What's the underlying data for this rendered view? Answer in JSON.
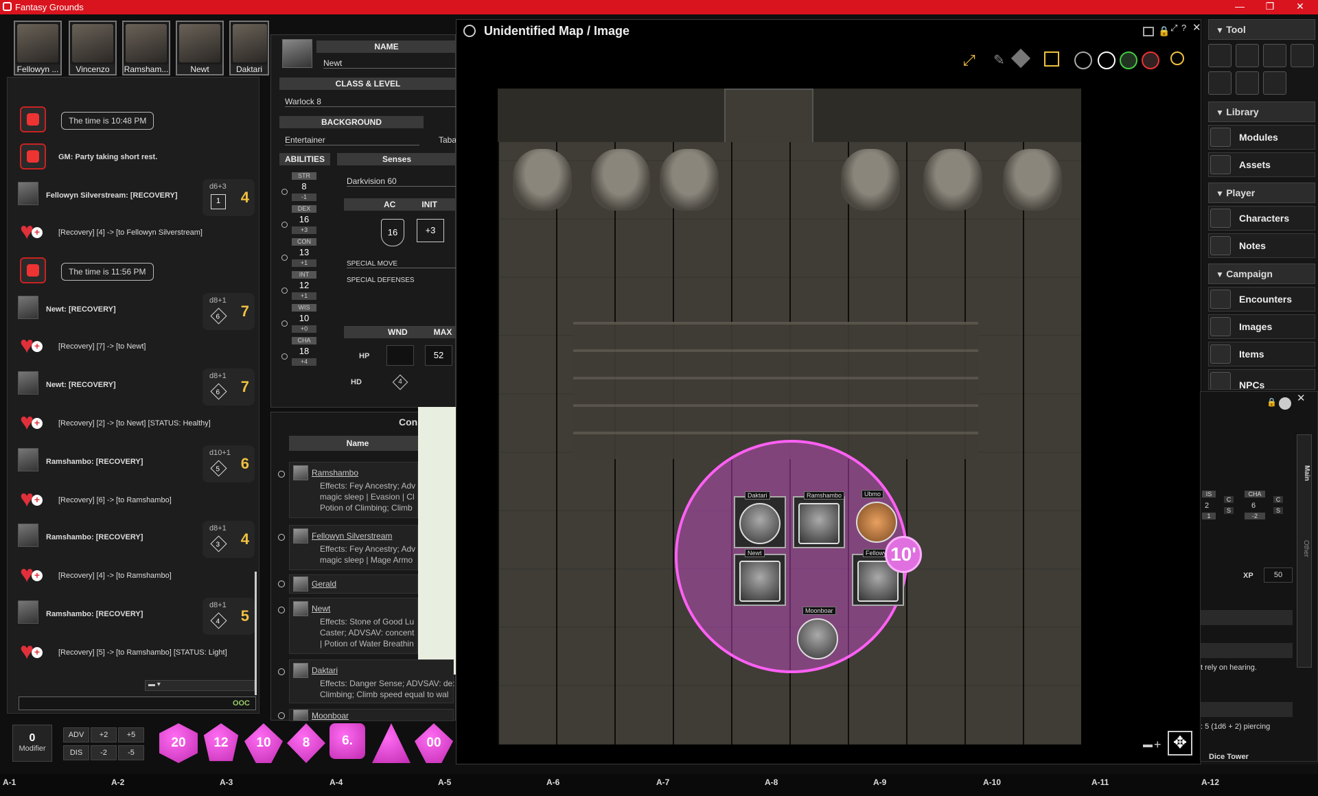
{
  "app": {
    "title": "Fantasy Grounds"
  },
  "party": [
    {
      "name": "Fellowyn ..."
    },
    {
      "name": "Vincenzo"
    },
    {
      "name": "Ramsham..."
    },
    {
      "name": "Newt"
    },
    {
      "name": "Daktari"
    }
  ],
  "chat": {
    "time1": "The time is 10:48 PM",
    "gm_msg": "GM:  Party taking short rest.",
    "time2": "The time is 11:56 PM",
    "ooc": "OOC",
    "rows": [
      {
        "actor": "Fellowyn Silverstream:",
        "tag": "[RECOVERY]",
        "formula": "d6+3",
        "die": "1",
        "total": "4"
      },
      {
        "text": "[Recovery] [4] -> [to Fellowyn Silverstream]"
      },
      {
        "actor": "Newt:",
        "tag": "[RECOVERY]",
        "formula": "d8+1",
        "die": "6",
        "total": "7"
      },
      {
        "text": "[Recovery] [7] -> [to Newt]"
      },
      {
        "actor": "Newt:",
        "tag": "[RECOVERY]",
        "formula": "d8+1",
        "die": "6",
        "total": "7"
      },
      {
        "text": "[Recovery] [2] -> [to Newt] [STATUS: Healthy]"
      },
      {
        "actor": "Ramshambo:",
        "tag": "[RECOVERY]",
        "formula": "d10+1",
        "die": "5",
        "total": "6"
      },
      {
        "text": "[Recovery] [6] -> [to Ramshambo]"
      },
      {
        "actor": "Ramshambo:",
        "tag": "[RECOVERY]",
        "formula": "d8+1",
        "die": "3",
        "total": "4"
      },
      {
        "text": "[Recovery] [4] -> [to Ramshambo]"
      },
      {
        "actor": "Ramshambo:",
        "tag": "[RECOVERY]",
        "formula": "d8+1",
        "die": "4",
        "total": "5"
      },
      {
        "text": "[Recovery] [5] -> [to Ramshambo] [STATUS: Light]"
      }
    ]
  },
  "modifier": {
    "value": "0",
    "label": "Modifier",
    "adv": "ADV",
    "dis": "DIS",
    "p2": "+2",
    "p5": "+5",
    "m2": "-2",
    "m5": "-5"
  },
  "dice": [
    "20",
    "12",
    "10",
    "8",
    "6.",
    "",
    "00"
  ],
  "sheet": {
    "name_hdr": "NAME",
    "name": "Newt",
    "class_hdr": "CLASS & LEVEL",
    "class": "Warlock 8",
    "bg_hdr": "BACKGROUND",
    "bg": "Entertainer",
    "bg_extra": "Taba",
    "abilities_hdr": "ABILITIES",
    "senses_hdr": "Senses",
    "senses": "Darkvision 60",
    "abilities": [
      {
        "l": "STR",
        "s": "8",
        "m": "-1"
      },
      {
        "l": "DEX",
        "s": "16",
        "m": "+3"
      },
      {
        "l": "CON",
        "s": "13",
        "m": "+1"
      },
      {
        "l": "INT",
        "s": "12",
        "m": "+1"
      },
      {
        "l": "WIS",
        "s": "10",
        "m": "+0"
      },
      {
        "l": "CHA",
        "s": "18",
        "m": "+4"
      }
    ],
    "ac_hdr": "AC",
    "init_hdr": "INIT",
    "ac": "16",
    "init": "+3",
    "special_move": "SPECIAL MOVE",
    "special_def": "SPECIAL DEFENSES",
    "wnd_hdr": "WND",
    "max_hdr": "MAX",
    "hp_lbl": "HP",
    "hp_max": "52",
    "hd_lbl": "HD",
    "hd": "4"
  },
  "combat": {
    "title": "Con",
    "col": "Name",
    "rows": [
      {
        "name": "Ramshambo",
        "eff": "Effects: Fey Ancestry; Adv",
        "eff2": "magic sleep | Evasion | Cl",
        "eff3": "Potion of Climbing; Climb"
      },
      {
        "name": "Fellowyn Silverstream",
        "eff": "Effects: Fey Ancestry; Adv",
        "eff2": "magic sleep | Mage Armo",
        "eff3": ""
      },
      {
        "name": "Gerald",
        "eff": "",
        "eff2": "",
        "eff3": ""
      },
      {
        "name": "Newt",
        "eff": "Effects: Stone of Good Lu",
        "eff2": "Caster; ADVSAV: concent",
        "eff3": "| Potion of Water Breathin"
      },
      {
        "name": "Daktari",
        "eff": "Effects: Danger Sense; ADVSAV: de:",
        "eff2": "Climbing; Climb speed equal to wal",
        "eff3": ""
      },
      {
        "name": "Moonboar",
        "eff": "",
        "eff2": "",
        "eff3": ""
      }
    ]
  },
  "map": {
    "title": "Unidentified Map / Image",
    "range": "10'",
    "tokens": [
      {
        "name": "Daktari"
      },
      {
        "name": "Ramshambo"
      },
      {
        "name": "Ubmo"
      },
      {
        "name": "Newt"
      },
      {
        "name": "Fellowyn"
      },
      {
        "name": "Moonboar"
      }
    ]
  },
  "sidebar": {
    "tool": "Tool",
    "library": "Library",
    "modules": "Modules",
    "assets": "Assets",
    "player": "Player",
    "characters": "Characters",
    "notes": "Notes",
    "campaign": "Campaign",
    "encounters": "Encounters",
    "images": "Images",
    "items": "Items",
    "npcs": "NPCs"
  },
  "subwin": {
    "is": "IS",
    "cha_l": "CHA",
    "v1": "2",
    "cha": "6",
    "m1": "1",
    "chm": "-2",
    "c": "C",
    "s": "S",
    "xp_lbl": "XP",
    "xp": "50",
    "t1": "t rely on hearing.",
    "t2": ": 5 (1d6 + 2) piercing",
    "main": "Main",
    "other": "Other",
    "dice_tower": "Dice Tower"
  },
  "grid": [
    "A-1",
    "A-2",
    "A-3",
    "A-4",
    "A-5",
    "A-6",
    "A-7",
    "A-8",
    "A-9",
    "A-10",
    "A-11",
    "A-12"
  ]
}
